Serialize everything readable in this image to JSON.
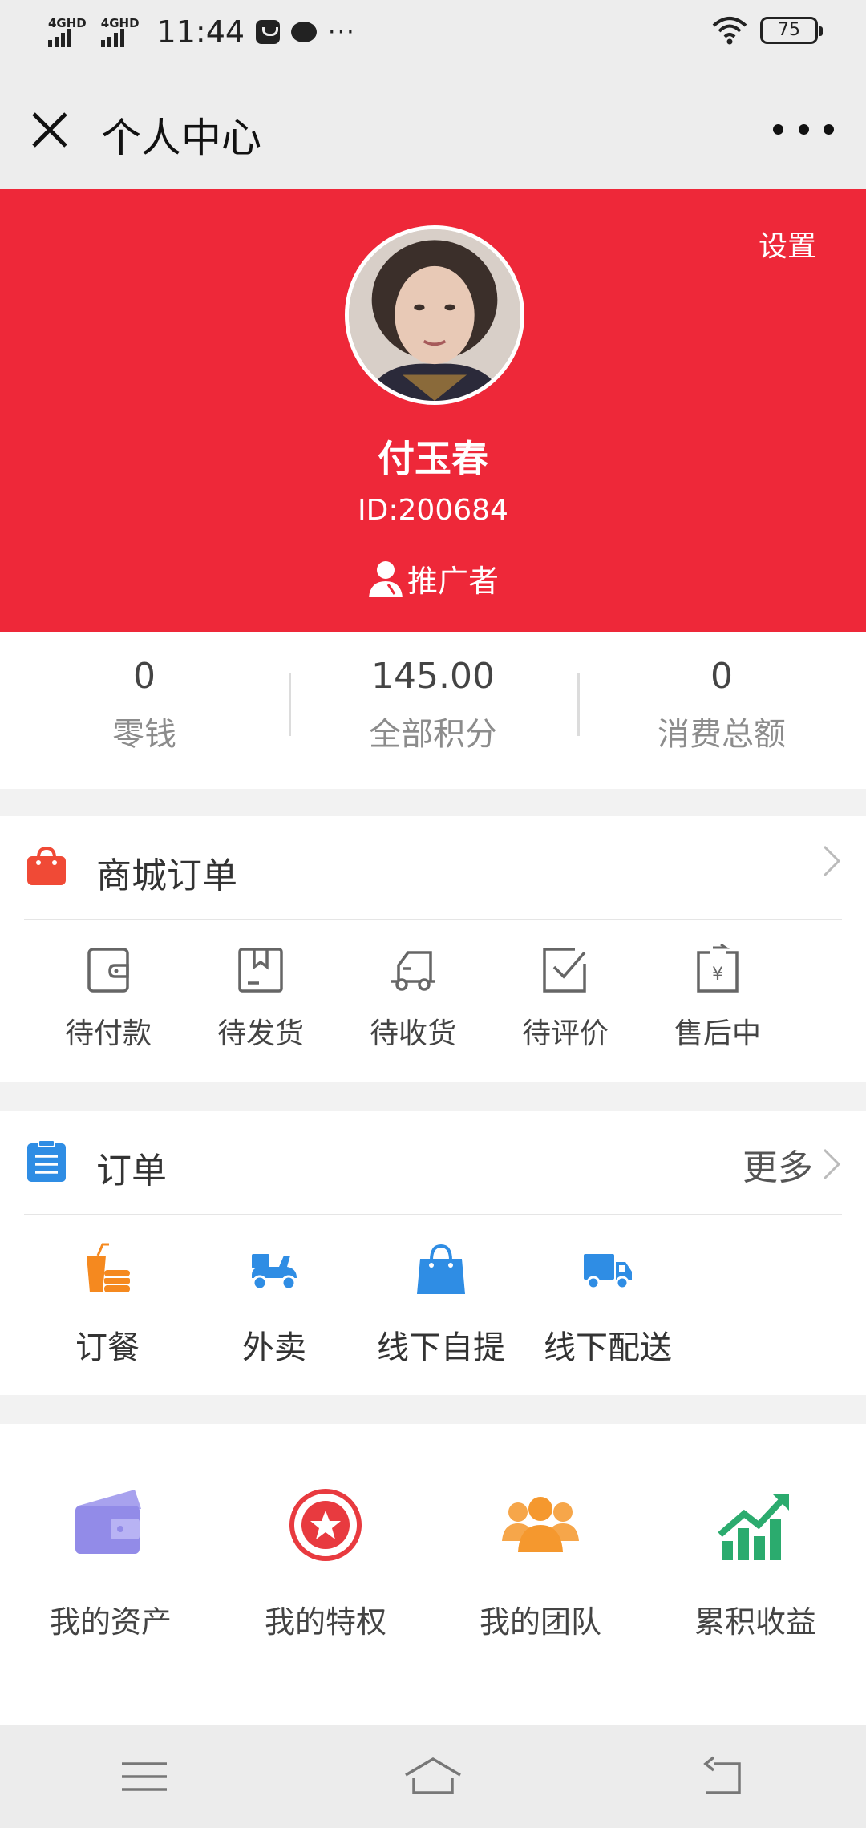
{
  "status_bar": {
    "signal1": "4GHD",
    "signal2": "4GHD",
    "time": "11:44",
    "more": "···",
    "battery": "75"
  },
  "nav": {
    "title": "个人中心",
    "close_icon": "close-icon",
    "more_icon": "more-icon"
  },
  "profile": {
    "settings_label": "设置",
    "name": "付玉春",
    "id": "ID:200684",
    "role": "推广者",
    "header_color": "#ee2839"
  },
  "stats": [
    {
      "value": "0",
      "label": "零钱"
    },
    {
      "value": "145.00",
      "label": "全部积分"
    },
    {
      "value": "0",
      "label": "消费总额"
    }
  ],
  "mall_orders": {
    "title": "商城订单",
    "items": [
      {
        "label": "待付款",
        "icon": "wallet-icon"
      },
      {
        "label": "待发货",
        "icon": "box-icon"
      },
      {
        "label": "待收货",
        "icon": "truck-icon"
      },
      {
        "label": "待评价",
        "icon": "check-icon"
      },
      {
        "label": "售后中",
        "icon": "refund-icon"
      }
    ]
  },
  "orders": {
    "title": "订单",
    "more_label": "更多",
    "items": [
      {
        "label": "订餐",
        "icon": "meal-icon"
      },
      {
        "label": "外卖",
        "icon": "scooter-icon"
      },
      {
        "label": "线下自提",
        "icon": "bag-icon"
      },
      {
        "label": "线下配送",
        "icon": "delivery-truck-icon"
      }
    ]
  },
  "assets": {
    "items": [
      {
        "label": "我的资产",
        "icon": "wallet-card-icon"
      },
      {
        "label": "我的特权",
        "icon": "star-badge-icon"
      },
      {
        "label": "我的团队",
        "icon": "team-icon"
      },
      {
        "label": "累积收益",
        "icon": "growth-chart-icon"
      }
    ]
  },
  "system_nav": {
    "menu_icon": "menu-icon",
    "home_icon": "home-icon",
    "back_icon": "back-icon"
  }
}
